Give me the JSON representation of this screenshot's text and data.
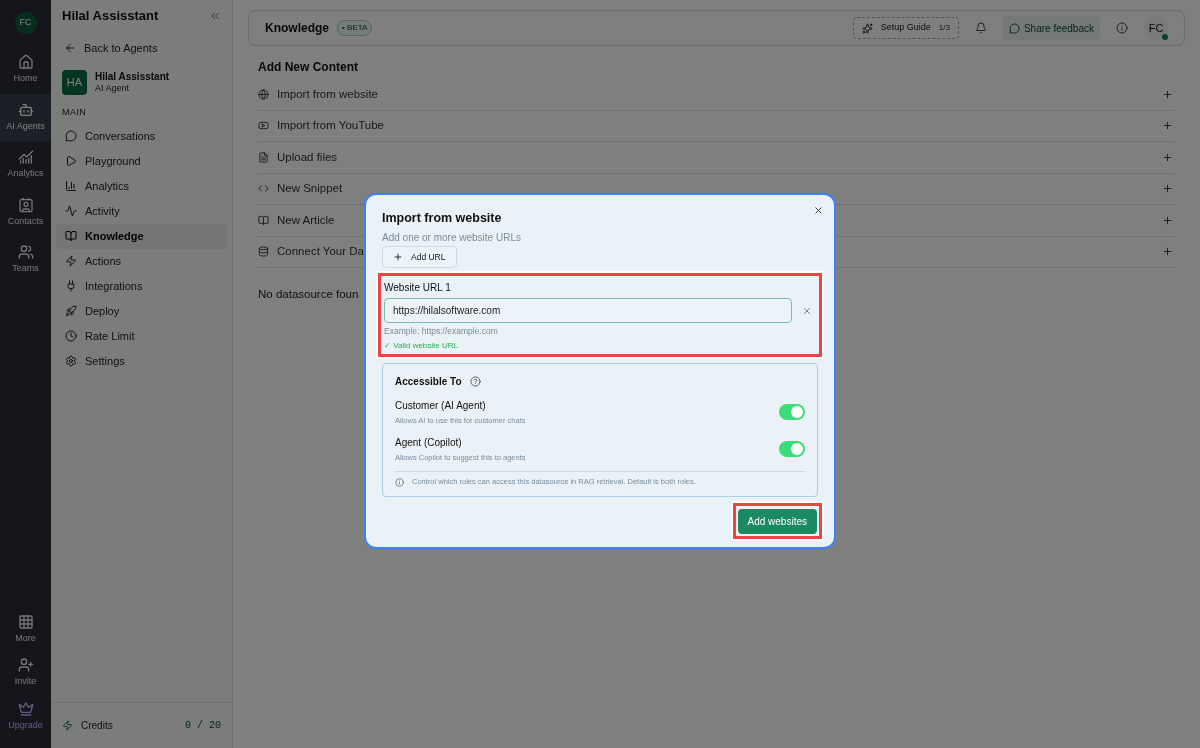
{
  "rail": {
    "avatar": "FC",
    "items": [
      {
        "label": "Home",
        "selected": false
      },
      {
        "label": "AI Agents",
        "selected": true
      },
      {
        "label": "Analytics",
        "selected": false
      },
      {
        "label": "Contacts",
        "selected": false
      },
      {
        "label": "Teams",
        "selected": false
      }
    ],
    "bottom_items": [
      {
        "label": "More"
      },
      {
        "label": "Invite"
      },
      {
        "label": "Upgrade"
      }
    ]
  },
  "sidebar": {
    "title": "Hilal Assisstant",
    "back": "Back to Agents",
    "agent": {
      "initials": "HA",
      "name": "Hilal Assisstant",
      "role": "AI Agent"
    },
    "section": "MAIN",
    "items": [
      {
        "label": "Conversations",
        "selected": false
      },
      {
        "label": "Playground",
        "selected": false
      },
      {
        "label": "Analytics",
        "selected": false
      },
      {
        "label": "Activity",
        "selected": false
      },
      {
        "label": "Knowledge",
        "selected": true
      },
      {
        "label": "Actions",
        "selected": false
      },
      {
        "label": "Integrations",
        "selected": false
      },
      {
        "label": "Deploy",
        "selected": false
      },
      {
        "label": "Rate Limit",
        "selected": false
      },
      {
        "label": "Settings",
        "selected": false
      }
    ],
    "credits": {
      "label": "Credits",
      "value": "0 / 20"
    }
  },
  "header": {
    "title": "Knowledge",
    "badge": "• BETA",
    "setup_guide": "Setup Guide",
    "setup_progress": "1/3",
    "feedback": "Share feedback",
    "avatar": "FC"
  },
  "content": {
    "heading": "Add New Content",
    "sources": [
      {
        "label": "Import from website"
      },
      {
        "label": "Import from YouTube"
      },
      {
        "label": "Upload files"
      },
      {
        "label": "New Snippet"
      },
      {
        "label": "New Article"
      },
      {
        "label": "Connect Your Da"
      }
    ],
    "empty": "No datasource foun"
  },
  "dialog": {
    "title": "Import from website",
    "subtitle": "Add one or more website URLs",
    "add_url": "Add URL",
    "urls": [
      {
        "label": "Website URL 1",
        "value": "https://hilalsoftware.com",
        "example": "Example: https://example.com",
        "validation": "✓ Valid website URL"
      }
    ],
    "access": {
      "title": "Accessible To",
      "roles": [
        {
          "kind": "toggle",
          "name": "Customer (AI Agent)",
          "description": "Allows AI to use this for customer chats",
          "on": true
        },
        {
          "kind": "toggle",
          "name": "Agent (Copilot)",
          "description": "Allows Copilot to suggest this to agents",
          "on": true
        }
      ],
      "note": "Control which roles can access this datasource in RAG retrieval. Default is both roles."
    },
    "submit": "Add websites"
  }
}
